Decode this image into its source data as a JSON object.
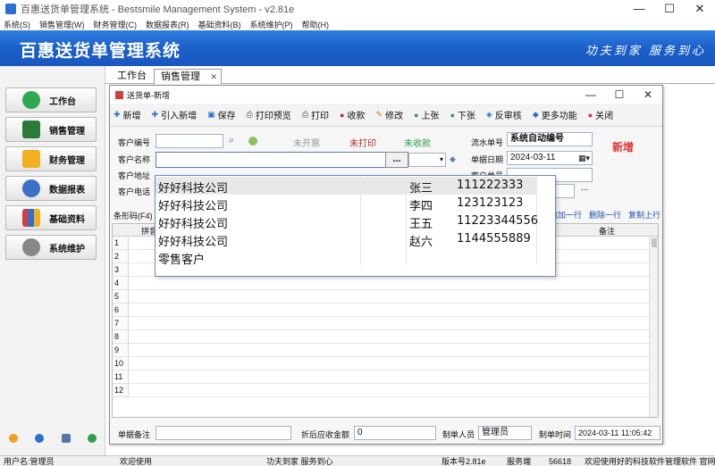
{
  "window": {
    "title": "百惠送货单管理系统 - Bestsmile Management System - v2.81e",
    "controls": [
      "—",
      "☐",
      "✕"
    ]
  },
  "menu": [
    "系统(S)",
    "销售管理(W)",
    "财务管理(C)",
    "数据报表(R)",
    "基础资料(B)",
    "系统维护(P)",
    "帮助(H)"
  ],
  "banner": {
    "brand": "百惠送货单管理系统",
    "slogan": "功夫到家 服务到心"
  },
  "sidebar": {
    "items": [
      {
        "label": "工作台",
        "icon": "check-circle-icon",
        "color": "#2fa84f"
      },
      {
        "label": "销售管理",
        "icon": "table-icon",
        "color": "#2a7a3a"
      },
      {
        "label": "财务管理",
        "icon": "folder-icon",
        "color": "#f0b020"
      },
      {
        "label": "数据报表",
        "icon": "magnifier-icon",
        "color": "#3a70c8"
      },
      {
        "label": "基础资料",
        "icon": "chart-icon",
        "color": "#d04040"
      },
      {
        "label": "系统维护",
        "icon": "gear-icon",
        "color": "#777777"
      }
    ]
  },
  "tabs": [
    {
      "label": "工作台"
    },
    {
      "label": "销售管理"
    }
  ],
  "dialog": {
    "title": "送货单-新增",
    "toolbar": [
      {
        "label": "新增",
        "icon": "plus-icon",
        "glyph": "✚",
        "color": "#2a6fd1"
      },
      {
        "label": "引入新增",
        "icon": "import-plus-icon",
        "glyph": "✚",
        "color": "#2a6fd1"
      },
      {
        "label": "保存",
        "icon": "save-icon",
        "glyph": "▣",
        "color": "#2a6fd1"
      },
      {
        "label": "打印预览",
        "icon": "print-preview-icon",
        "glyph": "⎙",
        "color": "#444444"
      },
      {
        "label": "打印",
        "icon": "print-icon",
        "glyph": "⎙",
        "color": "#444444"
      },
      {
        "label": "收款",
        "icon": "money-icon",
        "glyph": "●",
        "color": "#c03030"
      },
      {
        "label": "修改",
        "icon": "edit-icon",
        "glyph": "✎",
        "color": "#c08020"
      },
      {
        "label": "上张",
        "icon": "prev-icon",
        "glyph": "●",
        "color": "#2ca04a"
      },
      {
        "label": "下张",
        "icon": "next-icon",
        "glyph": "●",
        "color": "#2ca04a"
      },
      {
        "label": "反审核",
        "icon": "unaudit-icon",
        "glyph": "◈",
        "color": "#2a6fd1"
      },
      {
        "label": "更多功能",
        "icon": "more-icon",
        "glyph": "◆",
        "color": "#2a6fd1"
      },
      {
        "label": "关闭",
        "icon": "close-icon",
        "glyph": "●",
        "color": "#d03030"
      }
    ],
    "form": {
      "customer_code_label": "客户编号",
      "customer_name_label": "客户名称",
      "customer_addr_label": "客户地址",
      "customer_phone_label": "客户电话",
      "status_unopened": "未开票",
      "status_unprinted": "未打印",
      "status_uncollected": "未收款",
      "serial_label": "流水单号",
      "serial_value": "系统自动编号",
      "date_label": "单据日期",
      "date_value": "2024-03-11",
      "customer_order_label": "客户单号",
      "new_tag": "新增",
      "browse_button": "..."
    },
    "actions": {
      "barcode_label": "条形码(F4)",
      "add_row": "追加一行",
      "delete_row": "删除一行",
      "copy_row": "复制上行"
    },
    "grid": {
      "columns": [
        "拼音",
        "备注"
      ],
      "row_numbers": [
        "1",
        "2",
        "3",
        "4",
        "5",
        "6",
        "7",
        "8",
        "9",
        "10",
        "11",
        "12"
      ]
    },
    "footer": {
      "note_label": "单据备注",
      "discount_label": "折后应收金额",
      "discount_value": "0",
      "maker_label": "制单人员",
      "maker_value": "管理员",
      "time_label": "制单时间",
      "time_value": "2024-03-11 11:05:42"
    }
  },
  "popup": {
    "rows": [
      {
        "name": "好好科技公司",
        "contact": "张三",
        "phone": "111222333"
      },
      {
        "name": "好好科技公司",
        "contact": "李四",
        "phone": "123123123"
      },
      {
        "name": "好好科技公司",
        "contact": "王五",
        "phone": "11223344556"
      },
      {
        "name": "好好科技公司",
        "contact": "赵六",
        "phone": "1144555889"
      },
      {
        "name": "零售客户",
        "contact": "",
        "phone": ""
      }
    ]
  },
  "statusbar": {
    "user": "用户名:管理员",
    "welcome": "欢迎使用",
    "slogan": "功夫到家 服务到心",
    "version": "版本号2.81e",
    "server": "服务端",
    "port": "56618",
    "thanks": "欢迎使用好的科技软件管理软件 官网"
  }
}
